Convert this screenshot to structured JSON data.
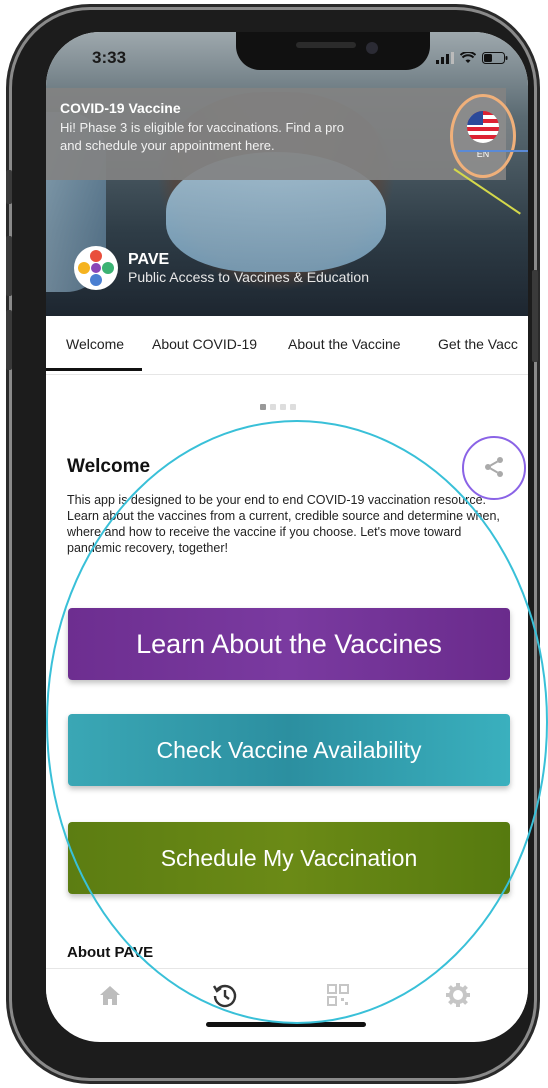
{
  "status_bar": {
    "time": "3:33"
  },
  "notification": {
    "title": "COVID-19 Vaccine",
    "body_line1": "Hi! Phase 3 is eligible for vaccinations. Find a pro",
    "body_line2": "and schedule your appointment here."
  },
  "language": {
    "code": "EN",
    "flag_icon": "us-flag-icon"
  },
  "brand": {
    "name": "PAVE",
    "subtitle": "Public Access to Vaccines & Education"
  },
  "tabs": [
    {
      "label": "Welcome",
      "active": true
    },
    {
      "label": "About COVID-19"
    },
    {
      "label": "About the Vaccine"
    },
    {
      "label": "Get the Vacc"
    }
  ],
  "pager": {
    "total": 4,
    "current": 1
  },
  "welcome": {
    "title": "Welcome",
    "text": "This app is designed to be your end to end COVID-19 vaccination resource. Learn about the vaccines from a current, credible source and determine when, where and how to receive the vaccine if you choose. Let's move toward pandemic recovery, together!"
  },
  "buttons": {
    "learn": "Learn About the Vaccines",
    "check": "Check Vaccine Availability",
    "schedule": "Schedule My Vaccination"
  },
  "about_heading": "About PAVE",
  "nav": [
    "home-icon",
    "history-icon",
    "qr-code-icon",
    "settings-gear-icon"
  ],
  "colors": {
    "learn_button": "#6d2e90",
    "check_button": "#2c8fa0",
    "schedule_button": "#5c7d12",
    "annotation_cyan": "#39c0d8",
    "annotation_purple": "#8a63e6",
    "annotation_orange": "#f0b07a"
  }
}
